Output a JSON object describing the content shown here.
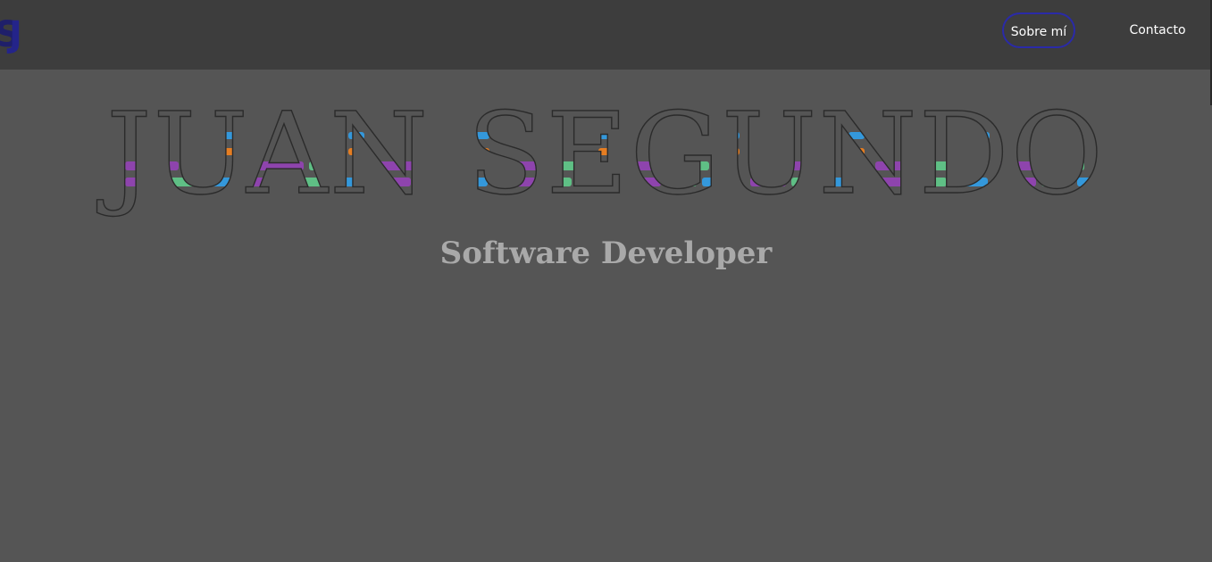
{
  "header": {
    "logo_letters": "SJ",
    "nav": [
      {
        "label": "Sobre mí"
      },
      {
        "label": "Contacto"
      }
    ]
  },
  "hero": {
    "title": "JUAN SEGUNDO",
    "subtitle": "Software Developer"
  },
  "colors": {
    "navbar_bg": "#3d3d3d",
    "page_bg": "#555555",
    "accent_border": "#2a2aa8",
    "stripe_purple": "#8e44ad",
    "stripe_green": "#5fbf85",
    "stripe_blue": "#3498db",
    "stripe_orange": "#e67e22"
  }
}
